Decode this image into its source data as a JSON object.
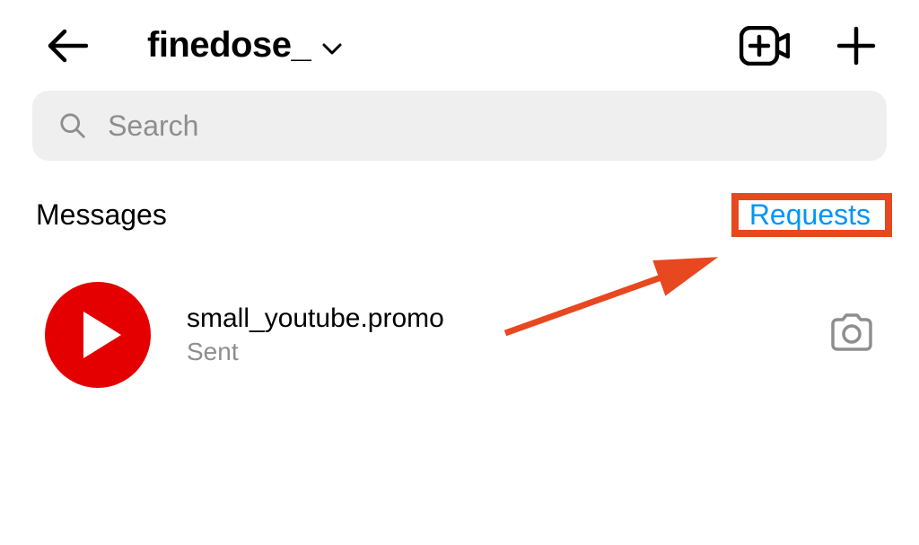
{
  "header": {
    "username": "finedose_"
  },
  "search": {
    "placeholder": "Search"
  },
  "section": {
    "messages_label": "Messages",
    "requests_label": "Requests"
  },
  "threads": [
    {
      "name": "small_youtube.promo",
      "status": "Sent"
    }
  ],
  "colors": {
    "link": "#0095f6",
    "highlight": "#e8481f",
    "avatar_bg": "#e40000",
    "muted": "#8e8e8e",
    "search_bg": "#efefef"
  }
}
